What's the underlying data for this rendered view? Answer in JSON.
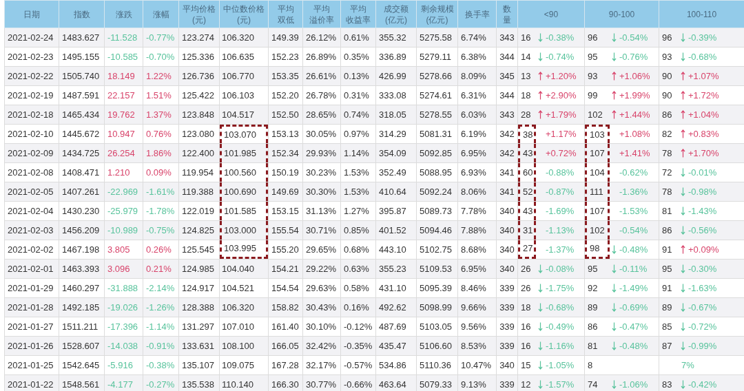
{
  "columns": [
    {
      "lines": [
        "日期"
      ]
    },
    {
      "lines": [
        "指数"
      ]
    },
    {
      "lines": [
        "涨跌"
      ]
    },
    {
      "lines": [
        "涨幅"
      ]
    },
    {
      "lines": [
        "平均价格",
        "(元)"
      ]
    },
    {
      "lines": [
        "中位数价格",
        "(元)"
      ]
    },
    {
      "lines": [
        "平均",
        "双低"
      ]
    },
    {
      "lines": [
        "平均",
        "溢价率"
      ]
    },
    {
      "lines": [
        "平均",
        "收益率"
      ]
    },
    {
      "lines": [
        "成交额",
        "(亿元)"
      ]
    },
    {
      "lines": [
        "剩余规模",
        "(亿元)"
      ]
    },
    {
      "lines": [
        "换手率"
      ]
    },
    {
      "lines": [
        "数",
        "量"
      ]
    },
    {
      "lines": [
        "<90"
      ]
    },
    {
      "lines": [
        "90-100"
      ]
    },
    {
      "lines": [
        "100-110"
      ]
    }
  ],
  "rows": [
    {
      "cells": [
        "2021-02-24",
        "1483.627",
        "-11.528",
        "-0.77%",
        "123.274",
        "106.320",
        "149.39",
        "26.12%",
        "0.61%",
        "355.32",
        "5275.58",
        "6.74%",
        "343"
      ],
      "up": false,
      "boxed": false,
      "buckets": [
        {
          "n": "16",
          "arrow": true,
          "pct": "-0.38%",
          "up": false
        },
        {
          "n": "96",
          "arrow": true,
          "pct": "-0.54%",
          "up": false
        },
        {
          "n": "96",
          "arrow": true,
          "pct": "-0.39%",
          "up": false
        }
      ]
    },
    {
      "cells": [
        "2021-02-23",
        "1495.155",
        "-10.585",
        "-0.70%",
        "125.336",
        "106.635",
        "152.23",
        "26.89%",
        "0.35%",
        "336.89",
        "5279.11",
        "6.38%",
        "344"
      ],
      "up": false,
      "boxed": false,
      "buckets": [
        {
          "n": "14",
          "arrow": true,
          "pct": "-0.74%",
          "up": false
        },
        {
          "n": "95",
          "arrow": true,
          "pct": "-0.76%",
          "up": false
        },
        {
          "n": "93",
          "arrow": true,
          "pct": "-0.68%",
          "up": false
        }
      ]
    },
    {
      "cells": [
        "2021-02-22",
        "1505.740",
        "18.149",
        "1.22%",
        "126.736",
        "106.770",
        "153.35",
        "26.61%",
        "0.13%",
        "426.99",
        "5278.66",
        "8.09%",
        "345"
      ],
      "up": true,
      "boxed": false,
      "buckets": [
        {
          "n": "13",
          "arrow": true,
          "pct": "+1.20%",
          "up": true
        },
        {
          "n": "93",
          "arrow": true,
          "pct": "+1.06%",
          "up": true
        },
        {
          "n": "90",
          "arrow": true,
          "pct": "+1.07%",
          "up": true
        }
      ]
    },
    {
      "cells": [
        "2021-02-19",
        "1487.591",
        "22.157",
        "1.51%",
        "125.422",
        "106.103",
        "152.20",
        "26.78%",
        "0.31%",
        "333.08",
        "5274.61",
        "6.31%",
        "344"
      ],
      "up": true,
      "boxed": false,
      "buckets": [
        {
          "n": "18",
          "arrow": true,
          "pct": "+2.90%",
          "up": true
        },
        {
          "n": "99",
          "arrow": true,
          "pct": "+1.99%",
          "up": true
        },
        {
          "n": "90",
          "arrow": true,
          "pct": "+1.72%",
          "up": true
        }
      ]
    },
    {
      "cells": [
        "2021-02-18",
        "1465.434",
        "19.762",
        "1.37%",
        "123.848",
        "104.517",
        "152.50",
        "28.65%",
        "0.74%",
        "318.05",
        "5278.55",
        "6.03%",
        "343"
      ],
      "up": true,
      "boxed": false,
      "buckets": [
        {
          "n": "28",
          "arrow": true,
          "pct": "+1.79%",
          "up": true
        },
        {
          "n": "102",
          "arrow": true,
          "pct": "+1.44%",
          "up": true
        },
        {
          "n": "86",
          "arrow": true,
          "pct": "+1.04%",
          "up": true
        }
      ]
    },
    {
      "cells": [
        "2021-02-10",
        "1445.672",
        "10.947",
        "0.76%",
        "123.080",
        "103.070",
        "153.13",
        "30.05%",
        "0.97%",
        "314.29",
        "5081.31",
        "6.19%",
        "342"
      ],
      "up": true,
      "boxed": true,
      "buckets": [
        {
          "n": "38",
          "arrow": false,
          "pct": "+1.17%",
          "up": true
        },
        {
          "n": "103",
          "arrow": false,
          "pct": "+1.08%",
          "up": true
        },
        {
          "n": "82",
          "arrow": true,
          "pct": "+0.83%",
          "up": true
        }
      ]
    },
    {
      "cells": [
        "2021-02-09",
        "1434.725",
        "26.254",
        "1.86%",
        "122.400",
        "101.985",
        "152.34",
        "29.93%",
        "1.14%",
        "354.09",
        "5092.85",
        "6.95%",
        "342"
      ],
      "up": true,
      "boxed": true,
      "buckets": [
        {
          "n": "43",
          "arrow": false,
          "pct": "+0.72%",
          "up": true
        },
        {
          "n": "107",
          "arrow": false,
          "pct": "+1.41%",
          "up": true
        },
        {
          "n": "78",
          "arrow": true,
          "pct": "+1.70%",
          "up": true
        }
      ]
    },
    {
      "cells": [
        "2021-02-08",
        "1408.471",
        "1.210",
        "0.09%",
        "119.954",
        "100.560",
        "150.19",
        "30.23%",
        "1.53%",
        "352.49",
        "5088.95",
        "6.93%",
        "341"
      ],
      "up": true,
      "boxed": true,
      "buckets": [
        {
          "n": "60",
          "arrow": false,
          "pct": "-0.88%",
          "up": false
        },
        {
          "n": "104",
          "arrow": false,
          "pct": "-0.62%",
          "up": false
        },
        {
          "n": "72",
          "arrow": true,
          "pct": "-0.01%",
          "up": false
        }
      ]
    },
    {
      "cells": [
        "2021-02-05",
        "1407.261",
        "-22.969",
        "-1.61%",
        "119.388",
        "100.690",
        "149.69",
        "30.30%",
        "1.53%",
        "410.64",
        "5092.24",
        "8.06%",
        "341"
      ],
      "up": false,
      "boxed": true,
      "buckets": [
        {
          "n": "52",
          "arrow": false,
          "pct": "-0.87%",
          "up": false
        },
        {
          "n": "111",
          "arrow": false,
          "pct": "-1.36%",
          "up": false
        },
        {
          "n": "78",
          "arrow": true,
          "pct": "-0.98%",
          "up": false
        }
      ]
    },
    {
      "cells": [
        "2021-02-04",
        "1430.230",
        "-25.979",
        "-1.78%",
        "122.019",
        "101.585",
        "153.15",
        "31.13%",
        "1.27%",
        "395.87",
        "5089.73",
        "7.78%",
        "340"
      ],
      "up": false,
      "boxed": true,
      "buckets": [
        {
          "n": "43",
          "arrow": false,
          "pct": "-1.69%",
          "up": false
        },
        {
          "n": "107",
          "arrow": false,
          "pct": "-1.53%",
          "up": false
        },
        {
          "n": "81",
          "arrow": true,
          "pct": "-1.43%",
          "up": false
        }
      ]
    },
    {
      "cells": [
        "2021-02-03",
        "1456.209",
        "-10.989",
        "-0.75%",
        "124.825",
        "103.000",
        "155.54",
        "30.71%",
        "0.85%",
        "401.52",
        "5094.46",
        "7.88%",
        "340"
      ],
      "up": false,
      "boxed": true,
      "buckets": [
        {
          "n": "31",
          "arrow": false,
          "pct": "-1.13%",
          "up": false
        },
        {
          "n": "102",
          "arrow": false,
          "pct": "-0.54%",
          "up": false
        },
        {
          "n": "86",
          "arrow": true,
          "pct": "-0.56%",
          "up": false
        }
      ]
    },
    {
      "cells": [
        "2021-02-02",
        "1467.198",
        "3.805",
        "0.26%",
        "125.545",
        "103.995",
        "155.20",
        "29.65%",
        "0.68%",
        "443.10",
        "5102.75",
        "8.68%",
        "340"
      ],
      "up": true,
      "boxed": true,
      "buckets": [
        {
          "n": "27",
          "arrow": false,
          "pct": "-1.37%",
          "up": false
        },
        {
          "n": "98",
          "arrow": true,
          "pct": "-0.48%",
          "up": false
        },
        {
          "n": "91",
          "arrow": true,
          "pct": "+0.09%",
          "up": true
        }
      ]
    },
    {
      "cells": [
        "2021-02-01",
        "1463.393",
        "3.096",
        "0.21%",
        "124.985",
        "104.040",
        "154.21",
        "29.22%",
        "0.63%",
        "355.23",
        "5109.53",
        "6.95%",
        "340"
      ],
      "up": true,
      "boxed": false,
      "buckets": [
        {
          "n": "26",
          "arrow": true,
          "pct": "-0.08%",
          "up": false
        },
        {
          "n": "95",
          "arrow": true,
          "pct": "-0.11%",
          "up": false
        },
        {
          "n": "95",
          "arrow": true,
          "pct": "-0.30%",
          "up": false
        }
      ]
    },
    {
      "cells": [
        "2021-01-29",
        "1460.297",
        "-31.888",
        "-2.14%",
        "124.917",
        "104.521",
        "154.54",
        "29.63%",
        "0.58%",
        "431.10",
        "5095.39",
        "8.46%",
        "339"
      ],
      "up": false,
      "boxed": false,
      "buckets": [
        {
          "n": "26",
          "arrow": true,
          "pct": "-1.75%",
          "up": false
        },
        {
          "n": "92",
          "arrow": true,
          "pct": "-1.49%",
          "up": false
        },
        {
          "n": "91",
          "arrow": true,
          "pct": "-1.63%",
          "up": false
        }
      ]
    },
    {
      "cells": [
        "2021-01-28",
        "1492.185",
        "-19.026",
        "-1.26%",
        "128.388",
        "106.320",
        "158.82",
        "30.43%",
        "0.16%",
        "492.62",
        "5098.99",
        "9.66%",
        "339"
      ],
      "up": false,
      "boxed": false,
      "buckets": [
        {
          "n": "18",
          "arrow": true,
          "pct": "-0.68%",
          "up": false
        },
        {
          "n": "89",
          "arrow": true,
          "pct": "-0.69%",
          "up": false
        },
        {
          "n": "89",
          "arrow": true,
          "pct": "-0.67%",
          "up": false
        }
      ]
    },
    {
      "cells": [
        "2021-01-27",
        "1511.211",
        "-17.396",
        "-1.14%",
        "131.297",
        "107.010",
        "161.40",
        "30.10%",
        "-0.12%",
        "487.69",
        "5103.05",
        "9.56%",
        "339"
      ],
      "up": false,
      "boxed": false,
      "buckets": [
        {
          "n": "16",
          "arrow": true,
          "pct": "-0.49%",
          "up": false
        },
        {
          "n": "86",
          "arrow": true,
          "pct": "-0.47%",
          "up": false
        },
        {
          "n": "85",
          "arrow": true,
          "pct": "-0.72%",
          "up": false
        }
      ]
    },
    {
      "cells": [
        "2021-01-26",
        "1528.607",
        "-14.038",
        "-0.91%",
        "133.631",
        "108.100",
        "166.05",
        "32.42%",
        "-0.35%",
        "435.47",
        "5106.60",
        "8.53%",
        "339"
      ],
      "up": false,
      "boxed": false,
      "buckets": [
        {
          "n": "16",
          "arrow": true,
          "pct": "-1.16%",
          "up": false
        },
        {
          "n": "81",
          "arrow": true,
          "pct": "-0.48%",
          "up": false
        },
        {
          "n": "87",
          "arrow": true,
          "pct": "-0.99%",
          "up": false
        }
      ]
    },
    {
      "cells": [
        "2021-01-25",
        "1542.645",
        "-5.916",
        "-0.38%",
        "135.107",
        "109.075",
        "167.28",
        "32.17%",
        "-0.57%",
        "534.86",
        "5110.36",
        "10.47%",
        "340"
      ],
      "up": false,
      "boxed": false,
      "buckets": [
        {
          "n": "15",
          "arrow": true,
          "pct": "-1.05%",
          "up": false
        },
        {
          "n": "8"
        },
        {
          "pct": "7%",
          "up": false
        }
      ]
    },
    {
      "cells": [
        "2021-01-22",
        "1548.561",
        "-4.177",
        "-0.27%",
        "135.538",
        "110.140",
        "166.30",
        "30.77%",
        "-0.66%",
        "463.64",
        "5079.33",
        "9.13%",
        "339"
      ],
      "up": false,
      "boxed": false,
      "buckets": [
        {
          "n": "12",
          "arrow": true,
          "pct": "-1.57%",
          "up": false
        },
        {
          "n": "74",
          "arrow": true,
          "pct": "-1.06%",
          "up": false
        },
        {
          "n": "83",
          "arrow": true,
          "pct": "-0.42%",
          "up": false
        }
      ]
    }
  ]
}
